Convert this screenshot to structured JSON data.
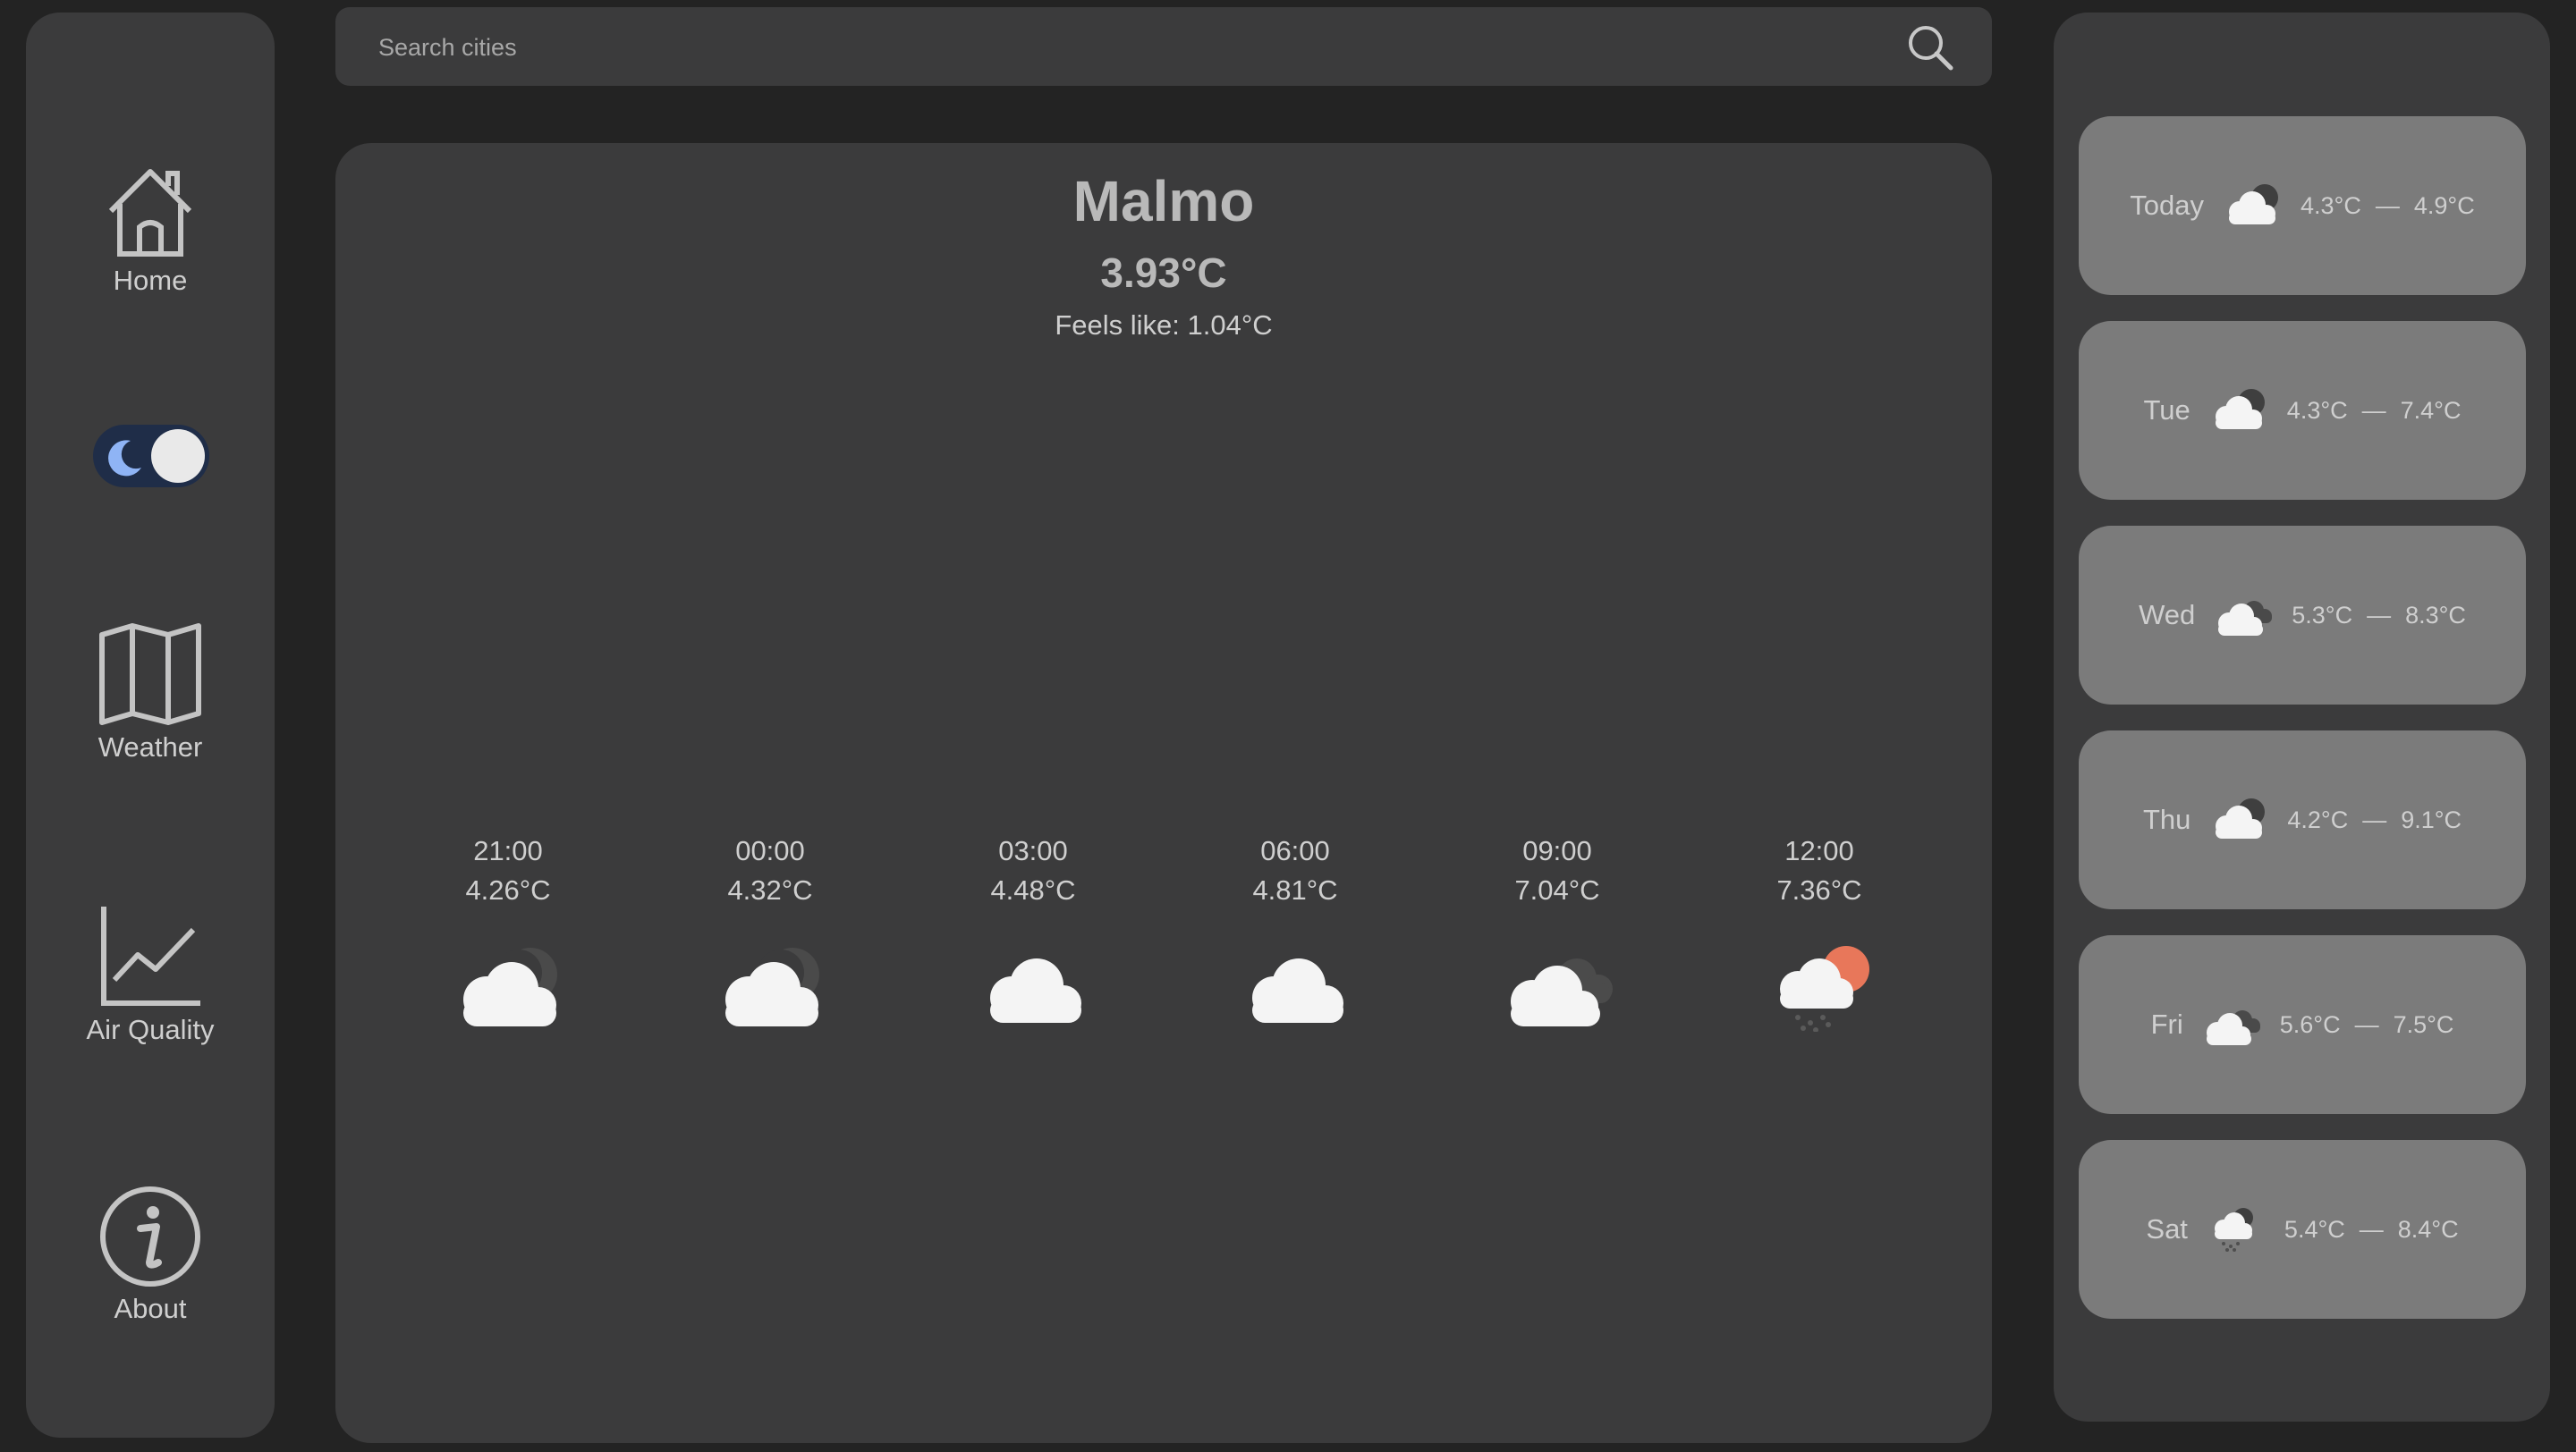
{
  "nav": {
    "home_label": "Home",
    "weather_label": "Weather",
    "air_label": "Air Quality",
    "about_label": "About",
    "theme_toggle": "dark"
  },
  "search": {
    "placeholder": "Search cities"
  },
  "current": {
    "city": "Malmo",
    "temp": "3.93°C",
    "feels_like": "Feels like: 1.04°C"
  },
  "hourly": [
    {
      "time": "21:00",
      "temp": "4.26°C",
      "icon": "cloud-moon-icon"
    },
    {
      "time": "00:00",
      "temp": "4.32°C",
      "icon": "cloud-moon-icon"
    },
    {
      "time": "03:00",
      "temp": "4.48°C",
      "icon": "cloud-icon"
    },
    {
      "time": "06:00",
      "temp": "4.81°C",
      "icon": "cloud-icon"
    },
    {
      "time": "09:00",
      "temp": "7.04°C",
      "icon": "clouds-icon"
    },
    {
      "time": "12:00",
      "temp": "7.36°C",
      "icon": "sun-cloud-rain-icon"
    }
  ],
  "forecast": [
    {
      "day": "Today",
      "low": "4.3°C",
      "high": "4.9°C",
      "icon": "cloud-moon-icon"
    },
    {
      "day": "Tue",
      "low": "4.3°C",
      "high": "7.4°C",
      "icon": "cloud-moon-icon"
    },
    {
      "day": "Wed",
      "low": "5.3°C",
      "high": "8.3°C",
      "icon": "clouds-icon"
    },
    {
      "day": "Thu",
      "low": "4.2°C",
      "high": "9.1°C",
      "icon": "cloud-moon-icon"
    },
    {
      "day": "Fri",
      "low": "5.6°C",
      "high": "7.5°C",
      "icon": "clouds-icon"
    },
    {
      "day": "Sat",
      "low": "5.4°C",
      "high": "8.4°C",
      "icon": "cloud-rain-icon"
    }
  ],
  "separator": "—",
  "colors": {
    "background": "#232323",
    "panel": "#3b3b3c",
    "card": "#7b7b7b",
    "text": "#cfcfcf",
    "toggle_bg": "#1f2d48",
    "moon": "#8fb4f5",
    "sun": "#e8775a"
  }
}
